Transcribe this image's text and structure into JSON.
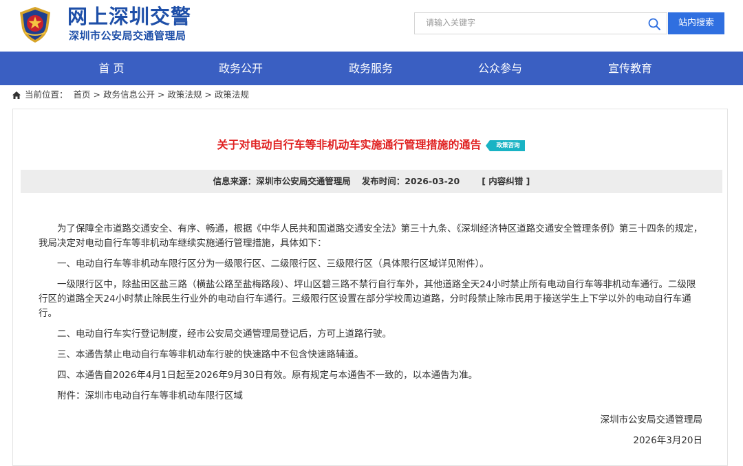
{
  "header": {
    "site_title": "网上深圳交警",
    "site_subtitle": "深圳市公安局交通管理局",
    "emblem_icon": "police-emblem-icon"
  },
  "search": {
    "placeholder": "请输入关键字",
    "button_label": "站内搜索",
    "icon": "search-icon"
  },
  "nav": {
    "items": [
      {
        "label": "首 页"
      },
      {
        "label": "政务公开"
      },
      {
        "label": "政务服务"
      },
      {
        "label": "公众参与"
      },
      {
        "label": "宣传教育"
      }
    ]
  },
  "breadcrumb": {
    "prefix": "当前位置：",
    "items": [
      "首页",
      "政务信息公开",
      "政策法规",
      "政策法规"
    ],
    "separator": ">"
  },
  "article": {
    "title": "关于对电动自行车等非机动车实施通行管理措施的通告",
    "tag": "政策咨询",
    "source_label": "信息来源：",
    "source": "深圳市公安局交通管理局",
    "time_label": "发布时间：",
    "time": "2026-03-20",
    "correction": "[ 内容纠错 ]",
    "paragraphs": [
      "为了保障全市道路交通安全、有序、畅通，根据《中华人民共和国道路交通安全法》第三十九条、《深圳经济特区道路交通安全管理条例》第三十四条的规定，我局决定对电动自行车等非机动车继续实施通行管理措施，具体如下：",
      "一、电动自行车等非机动车限行区分为一级限行区、二级限行区、三级限行区（具体限行区域详见附件）。",
      "一级限行区中，除盐田区盐三路（横盐公路至盐梅路段）、坪山区碧三路不禁行自行车外，其他道路全天24小时禁止所有电动自行车等非机动车通行。二级限行区的道路全天24小时禁止除民生行业外的电动自行车通行。三级限行区设置在部分学校周边道路，分时段禁止除市民用于接送学生上下学以外的电动自行车通行。",
      "二、电动自行车实行登记制度，经市公安局交通管理局登记后，方可上道路行驶。",
      "三、本通告禁止电动自行车等非机动车行驶的快速路中不包含快速路辅道。",
      "四、本通告自2026年4月1日起至2026年9月30日有效。原有规定与本通告不一致的，以本通告为准。",
      "附件：深圳市电动自行车等非机动车限行区域"
    ],
    "signature": "深圳市公安局交通管理局",
    "date": "2026年3月20日"
  },
  "colors": {
    "brand_blue": "#1e4fa8",
    "nav_blue": "#3a5fc2",
    "search_button": "#2f6fe0",
    "title_red": "#e02020",
    "tag_teal": "#19b3c4"
  }
}
